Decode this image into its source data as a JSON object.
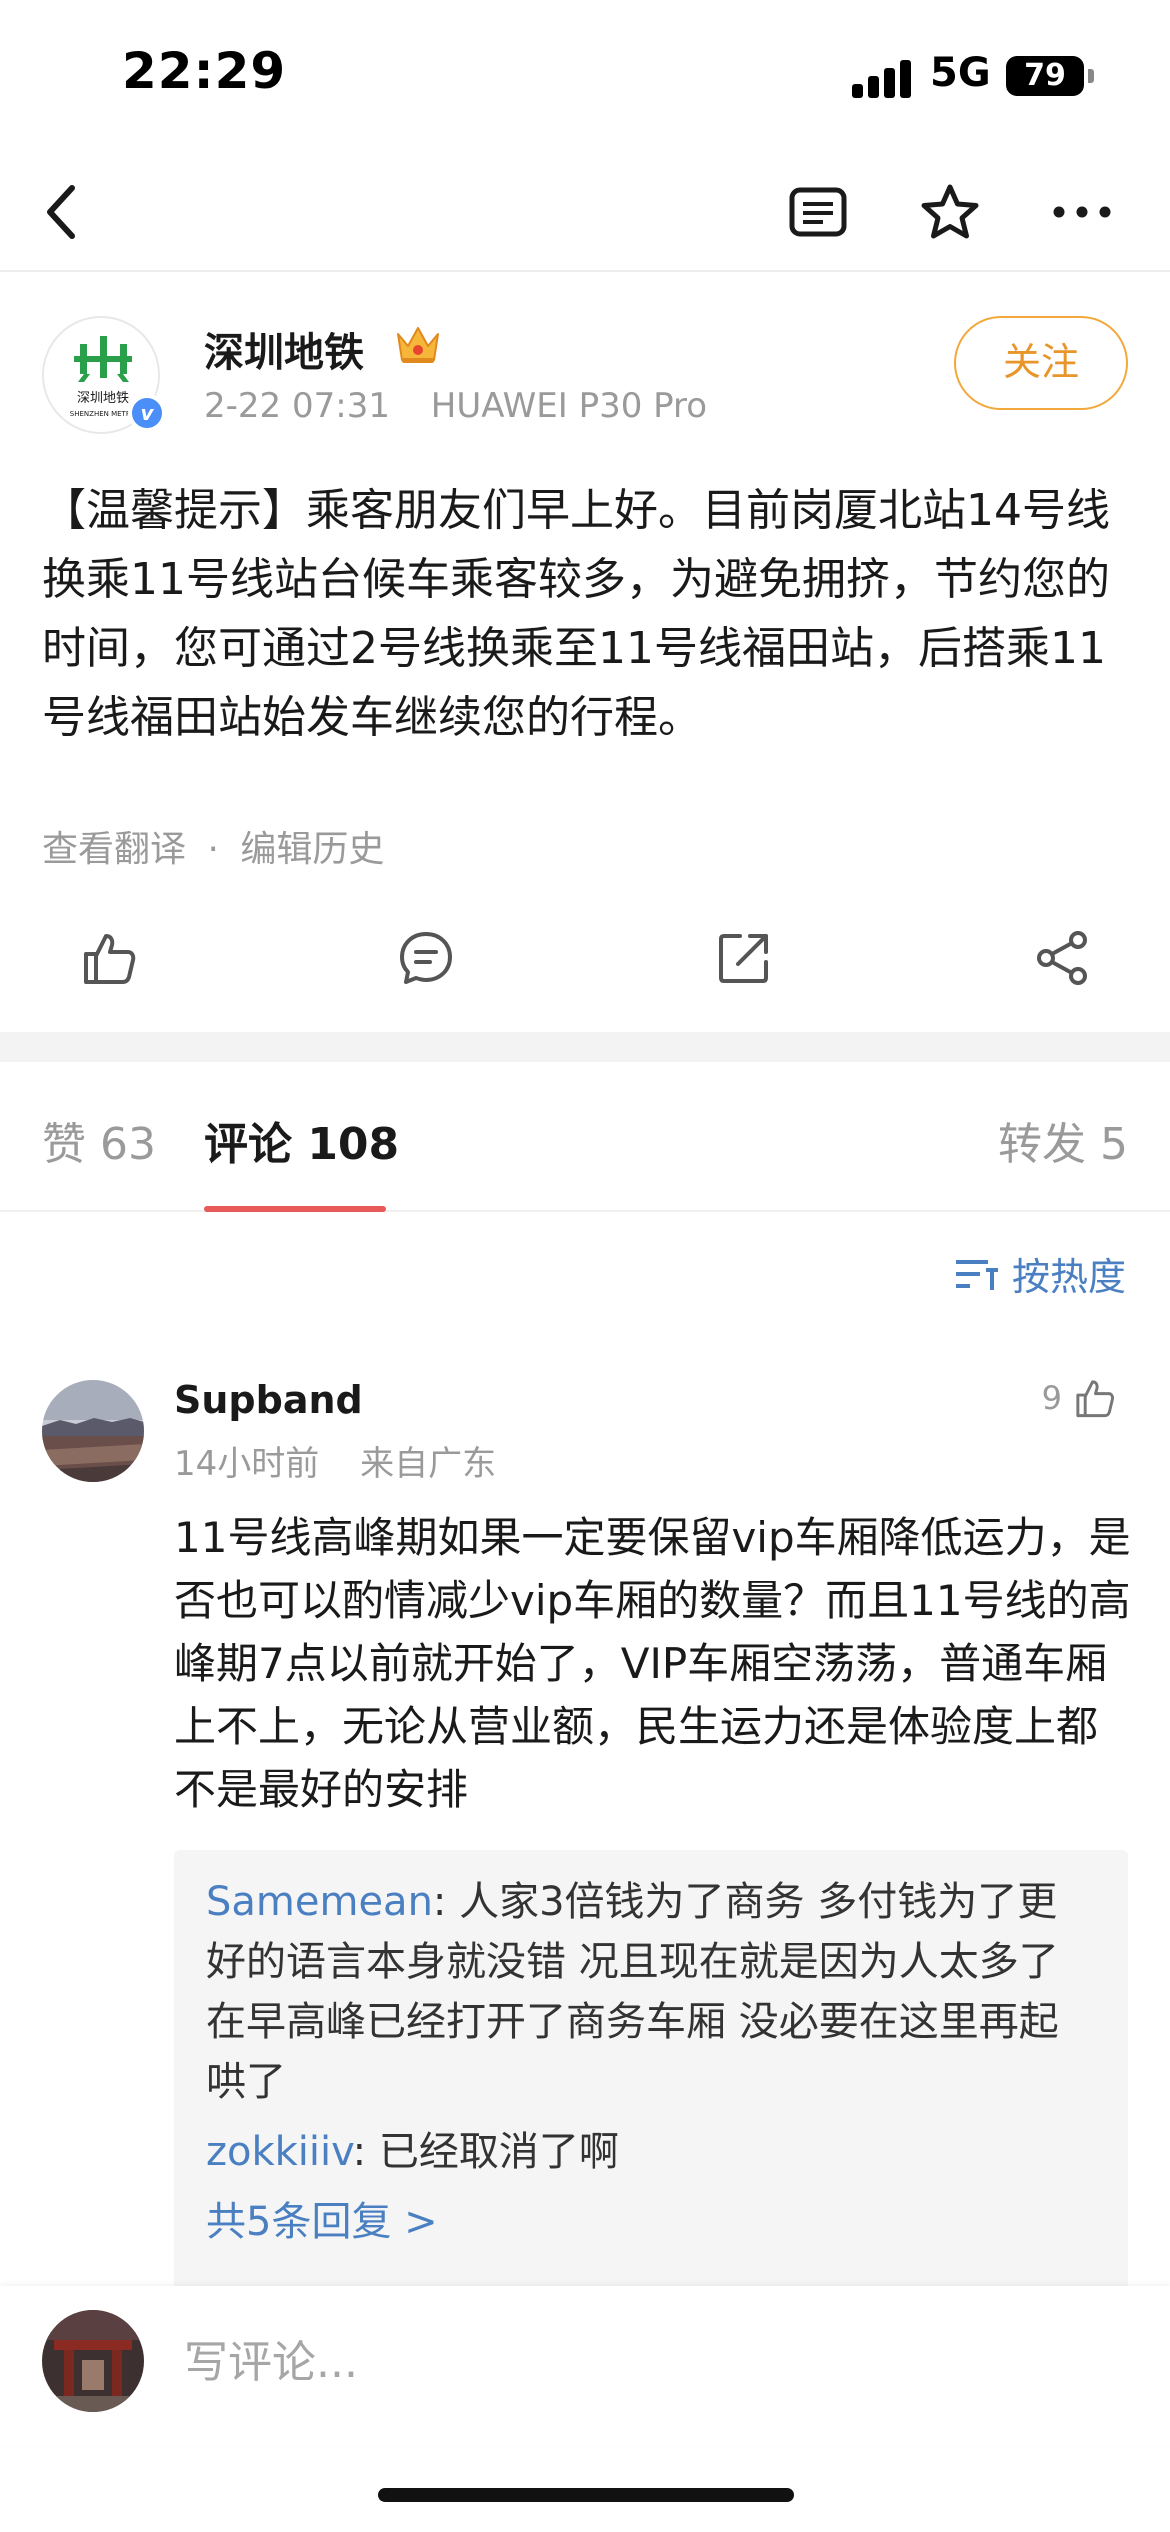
{
  "status_bar": {
    "time": "22:29",
    "network": "5G",
    "battery": "79"
  },
  "nav": {
    "back_icon": "chevron-left-icon",
    "icons": [
      "article-icon",
      "star-icon",
      "more-icon"
    ]
  },
  "post": {
    "author": "深圳地铁",
    "badge_icon": "crown-icon",
    "time": "2-22 07:31",
    "device": "HUAWEI P30 Pro",
    "follow_label": "关注",
    "body": "【温馨提示】乘客朋友们早上好。目前岗厦北站14号线换乘11号线站台候车乘客较多，为避免拥挤，节约您的时间，您可通过2号线换乘至11号线福田站，后搭乘11号线福田站始发车继续您的行程。",
    "translate_link": "查看翻译",
    "separator": "·",
    "history_link": "编辑历史",
    "logo_text": "深圳地铁",
    "logo_subtext": "SHENZHEN METRO"
  },
  "tabs": {
    "likes": "赞 63",
    "comments": "评论 108",
    "reposts": "转发 5"
  },
  "sort_label": "按热度",
  "comment": {
    "user": "Supband",
    "time": "14小时前",
    "location": "来自广东",
    "likes": "9",
    "body": "11号线高峰期如果一定要保留vip车厢降低运力，是否也可以酌情减少vip车厢的数量？而且11号线的高峰期7点以前就开始了，VIP车厢空荡荡，普通车厢上不上，无论从营业额，民生运力还是体验度上都不是最好的安排",
    "replies": [
      {
        "name": "Samemean",
        "text": ": 人家3倍钱为了商务 多付钱为了更好的语言本身就没错 况且现在就是因为人太多了在早高峰已经打开了商务车厢 没必要在这里再起哄了"
      },
      {
        "name": "zokkiiiv",
        "text": ": 已经取消了啊"
      }
    ],
    "more_replies": "共5条回复 >"
  },
  "composer": {
    "placeholder": "写评论..."
  },
  "colors": {
    "accent_orange": "#e8952a",
    "link_blue": "#4a7fc1",
    "tab_red": "#e85a5a"
  }
}
